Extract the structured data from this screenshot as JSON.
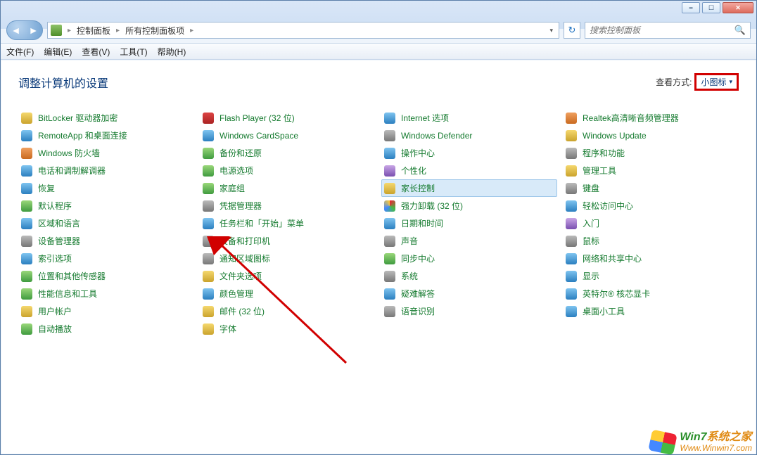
{
  "breadcrumb": {
    "seg1": "控制面板",
    "seg2": "所有控制面板项"
  },
  "search": {
    "placeholder": "搜索控制面板"
  },
  "menus": {
    "file": "文件(F)",
    "edit": "编辑(E)",
    "view": "查看(V)",
    "tools": "工具(T)",
    "help": "帮助(H)"
  },
  "header": {
    "title": "调整计算机的设置",
    "view_label": "查看方式:",
    "view_value": "小图标"
  },
  "selected_index": 18,
  "items": [
    {
      "label": "BitLocker 驱动器加密",
      "ic": "c1"
    },
    {
      "label": "Flash Player (32 位)",
      "ic": "c2"
    },
    {
      "label": "Internet 选项",
      "ic": "c3"
    },
    {
      "label": "Realtek高清晰音频管理器",
      "ic": "c6"
    },
    {
      "label": "RemoteApp 和桌面连接",
      "ic": "c3"
    },
    {
      "label": "Windows CardSpace",
      "ic": "c3"
    },
    {
      "label": "Windows Defender",
      "ic": "c7"
    },
    {
      "label": "Windows Update",
      "ic": "c1"
    },
    {
      "label": "Windows 防火墙",
      "ic": "c6"
    },
    {
      "label": "备份和还原",
      "ic": "c4"
    },
    {
      "label": "操作中心",
      "ic": "c3"
    },
    {
      "label": "程序和功能",
      "ic": "c7"
    },
    {
      "label": "电话和调制解调器",
      "ic": "c3"
    },
    {
      "label": "电源选项",
      "ic": "c4"
    },
    {
      "label": "个性化",
      "ic": "c5"
    },
    {
      "label": "管理工具",
      "ic": "c1"
    },
    {
      "label": "恢复",
      "ic": "c3"
    },
    {
      "label": "家庭组",
      "ic": "c4"
    },
    {
      "label": "家长控制",
      "ic": "c1"
    },
    {
      "label": "键盘",
      "ic": "c7"
    },
    {
      "label": "默认程序",
      "ic": "c4"
    },
    {
      "label": "凭据管理器",
      "ic": "c7"
    },
    {
      "label": "强力卸载 (32 位)",
      "ic": "c8"
    },
    {
      "label": "轻松访问中心",
      "ic": "c3"
    },
    {
      "label": "区域和语言",
      "ic": "c3"
    },
    {
      "label": "任务栏和「开始」菜单",
      "ic": "c3"
    },
    {
      "label": "日期和时间",
      "ic": "c3"
    },
    {
      "label": "入门",
      "ic": "c5"
    },
    {
      "label": "设备管理器",
      "ic": "c7"
    },
    {
      "label": "设备和打印机",
      "ic": "c7"
    },
    {
      "label": "声音",
      "ic": "c7"
    },
    {
      "label": "鼠标",
      "ic": "c7"
    },
    {
      "label": "索引选项",
      "ic": "c3"
    },
    {
      "label": "通知区域图标",
      "ic": "c7"
    },
    {
      "label": "同步中心",
      "ic": "c4"
    },
    {
      "label": "网络和共享中心",
      "ic": "c3"
    },
    {
      "label": "位置和其他传感器",
      "ic": "c4"
    },
    {
      "label": "文件夹选项",
      "ic": "c1"
    },
    {
      "label": "系统",
      "ic": "c7"
    },
    {
      "label": "显示",
      "ic": "c3"
    },
    {
      "label": "性能信息和工具",
      "ic": "c4"
    },
    {
      "label": "颜色管理",
      "ic": "c3"
    },
    {
      "label": "疑难解答",
      "ic": "c3"
    },
    {
      "label": "英特尔® 核芯显卡",
      "ic": "c3"
    },
    {
      "label": "用户帐户",
      "ic": "c1"
    },
    {
      "label": "邮件 (32 位)",
      "ic": "c1"
    },
    {
      "label": "语音识别",
      "ic": "c7"
    },
    {
      "label": "桌面小工具",
      "ic": "c3"
    },
    {
      "label": "自动播放",
      "ic": "c4"
    },
    {
      "label": "字体",
      "ic": "c1"
    }
  ],
  "watermark": {
    "line1a": "Win7",
    "line1b": "系统之家",
    "line2": "Www.Winwin7.com"
  }
}
